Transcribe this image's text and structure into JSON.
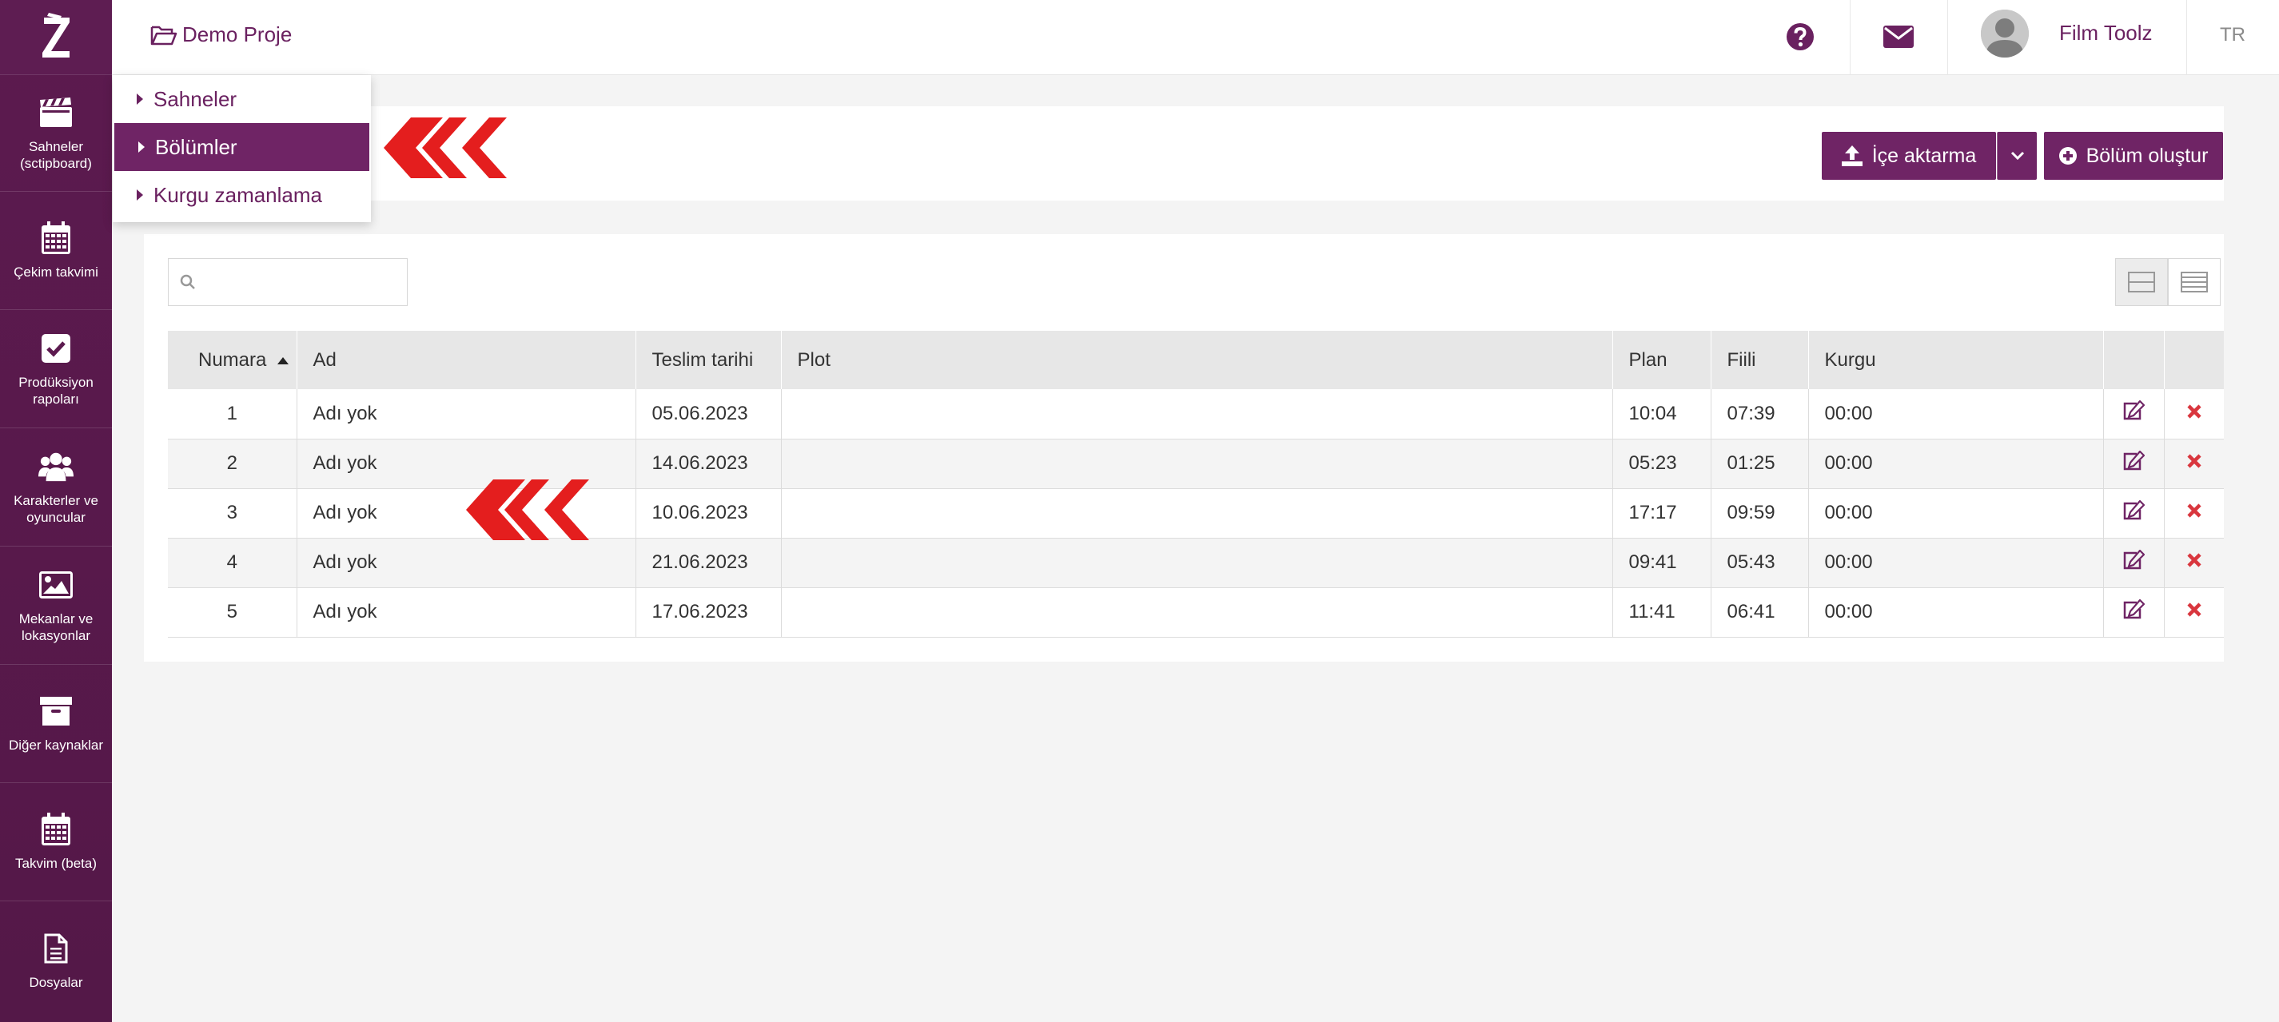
{
  "brand": {
    "logo_letter": "Z"
  },
  "sidebar": {
    "items": [
      {
        "label": "Sahneler (sctipboard)",
        "icon": "clapperboard-icon"
      },
      {
        "label": "Çekim takvimi",
        "icon": "calendar-icon"
      },
      {
        "label": "Prodüksiyon rapoları",
        "icon": "checkbox-icon"
      },
      {
        "label": "Karakterler ve oyuncular",
        "icon": "users-icon"
      },
      {
        "label": "Mekanlar ve lokasyonlar",
        "icon": "image-icon"
      },
      {
        "label": "Diğer kaynaklar",
        "icon": "archive-icon"
      },
      {
        "label": "Takvim (beta)",
        "icon": "calendar-icon"
      },
      {
        "label": "Dosyalar",
        "icon": "file-icon"
      }
    ]
  },
  "topbar": {
    "project": "Demo Proje",
    "user_name": "Film Toolz",
    "language": "TR"
  },
  "menu": {
    "items": [
      {
        "label": "Sahneler",
        "active": false
      },
      {
        "label": "Bölümler",
        "active": true
      },
      {
        "label": "Kurgu zamanlama",
        "active": false
      }
    ]
  },
  "actions": {
    "import_label": "İçe aktarma",
    "create_label": "Bölüm oluştur"
  },
  "search": {
    "placeholder": ""
  },
  "table": {
    "columns": [
      "Numara",
      "Ad",
      "Teslim tarihi",
      "Plot",
      "Plan",
      "Fiili",
      "Kurgu"
    ],
    "rows": [
      {
        "numara": "1",
        "ad": "Adı yok",
        "teslim": "05.06.2023",
        "plot": "",
        "plan": "10:04",
        "fiili": "07:39",
        "kurgu": "00:00"
      },
      {
        "numara": "2",
        "ad": "Adı yok",
        "teslim": "14.06.2023",
        "plot": "",
        "plan": "05:23",
        "fiili": "01:25",
        "kurgu": "00:00"
      },
      {
        "numara": "3",
        "ad": "Adı yok",
        "teslim": "10.06.2023",
        "plot": "",
        "plan": "17:17",
        "fiili": "09:59",
        "kurgu": "00:00"
      },
      {
        "numara": "4",
        "ad": "Adı yok",
        "teslim": "21.06.2023",
        "plot": "",
        "plan": "09:41",
        "fiili": "05:43",
        "kurgu": "00:00"
      },
      {
        "numara": "5",
        "ad": "Adı yok",
        "teslim": "17.06.2023",
        "plot": "",
        "plan": "11:41",
        "fiili": "06:41",
        "kurgu": "00:00"
      }
    ]
  },
  "colors": {
    "primary": "#6f2465",
    "sidebar": "#5c1a4f",
    "delete": "#d9363e",
    "annotation": "#e41e1e"
  }
}
